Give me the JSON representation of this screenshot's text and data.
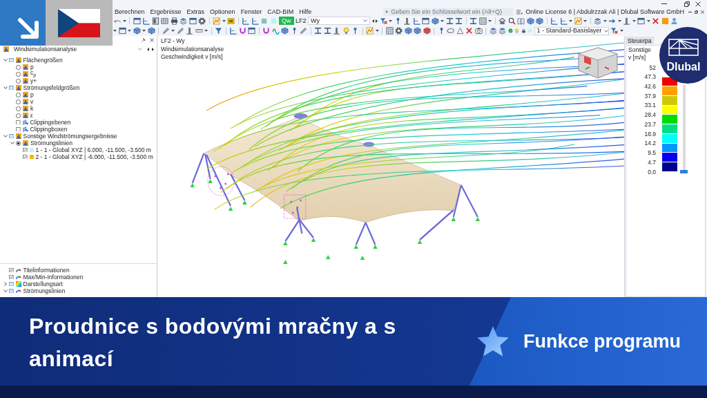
{
  "menu": [
    "Berechnen",
    "Ergebnisse",
    "Extras",
    "Optionen",
    "Fenster",
    "CAD-BIM",
    "Hilfe"
  ],
  "search": {
    "placeholder": "Geben Sie ein Schlüsselwort ein (Alt+Q)"
  },
  "license": "Online License 6 | Abdulrzzak Ali | Dlubal Software GmbH",
  "load_case": {
    "type_tag": "Qw",
    "number": "LF2",
    "name": "Wy"
  },
  "layer": {
    "name": "1 - Standard-Basislayer"
  },
  "navigator": {
    "title": "Windsimulationsanalyse",
    "tree": [
      {
        "label": "Flächengrößen",
        "kind": "group",
        "checked": false,
        "expanded": true,
        "children": [
          {
            "label": "p",
            "kind": "radio",
            "selected": false
          },
          {
            "label": "c$_{p}$",
            "kind": "radio",
            "selected": false
          },
          {
            "label": "y+",
            "kind": "radio",
            "selected": false
          }
        ]
      },
      {
        "label": "Strömungsfeldgrößen",
        "kind": "group",
        "checked": false,
        "expanded": true,
        "children": [
          {
            "label": "p",
            "kind": "radio",
            "selected": false
          },
          {
            "label": "v",
            "kind": "radio",
            "selected": false
          },
          {
            "label": "k",
            "kind": "radio",
            "selected": false
          },
          {
            "label": "ε",
            "kind": "radio",
            "selected": false
          },
          {
            "label": "Clippingebenen",
            "kind": "clip",
            "checked": false
          },
          {
            "label": "Clippingboxen",
            "kind": "clip",
            "checked": false
          }
        ]
      },
      {
        "label": "Sonstige Windströmungsergebnisse",
        "kind": "group",
        "checked": false,
        "expanded": true,
        "children": [
          {
            "label": "Strömungslinien",
            "kind": "radio",
            "selected": true,
            "expanded": true,
            "children": [
              {
                "label": "1 - 1 - Global XYZ | 6.000, -11.500, -3.500 m",
                "kind": "series",
                "checked": true,
                "color": "#c8f4f8"
              },
              {
                "label": "2 - 1 - Global XYZ | -6.000, -11.500, -3.500 m",
                "kind": "series",
                "checked": true,
                "color": "#f5b800"
              }
            ]
          }
        ]
      }
    ],
    "display_tree": [
      {
        "label": "Titelinformationen",
        "kind": "info",
        "checked": true
      },
      {
        "label": "Max/Min-Informationen",
        "kind": "info",
        "checked": true
      },
      {
        "label": "Darstellungsart",
        "kind": "style",
        "checked": false,
        "expanded": false
      },
      {
        "label": "Strömungslinien",
        "kind": "info",
        "checked": false,
        "expanded": true
      }
    ]
  },
  "viewport": {
    "info_lines": [
      "LF2 - Wy",
      "Windsimulationsanalyse",
      "Geschwindigkeit v [m/s]"
    ]
  },
  "control_panel": {
    "tab": "Steuerpa",
    "result_type": "Sonstige",
    "unit": "v [m/s]",
    "legend_labels": [
      "52",
      "47.3",
      "42.6",
      "37.9",
      "33.1",
      "28.4",
      "23.7",
      "18.9",
      "14.2",
      "9.5",
      "4.7",
      "0.0"
    ],
    "legend_bands": [
      {
        "color": "#f00000"
      },
      {
        "color": "#ffa200"
      },
      {
        "color": "#d2c800"
      },
      {
        "color": "#ffff00"
      },
      {
        "color": "#00dc00"
      },
      {
        "color": "#00e080"
      },
      {
        "color": "#00ffff"
      },
      {
        "color": "#0096ff"
      },
      {
        "color": "#0000f0"
      },
      {
        "color": "#000090"
      }
    ],
    "slider": {
      "level": 0
    }
  },
  "logo": {
    "brand": "Dlubal"
  },
  "banner": {
    "title": "Proudnice s bodovými mračny a s animací",
    "label": "Funkce programu"
  }
}
